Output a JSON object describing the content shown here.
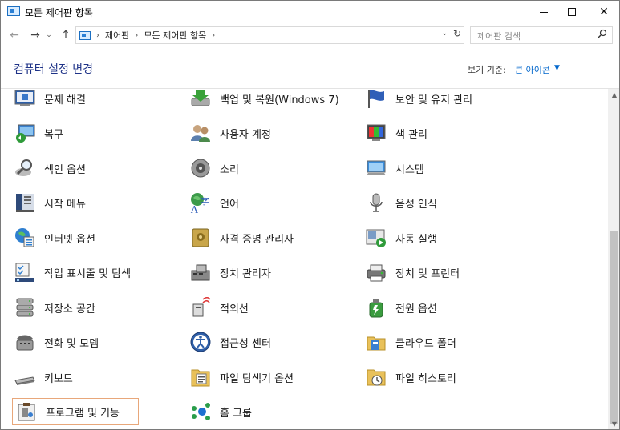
{
  "window": {
    "title": "모든 제어판 항목",
    "controls": {
      "minimize": "minimize",
      "maximize": "maximize",
      "close": "✕"
    }
  },
  "nav": {
    "back": "←",
    "forward": "→",
    "recent": "⌄",
    "up": "↑",
    "breadcrumbs": [
      "제어판",
      "모든 제어판 항목"
    ],
    "dropdown": "⌄",
    "refresh": "↻"
  },
  "search": {
    "placeholder": "제어판 검색"
  },
  "header": {
    "title": "컴퓨터 설정 변경",
    "view_by_label": "보기 기준:",
    "view_by_value": "큰 아이콘",
    "view_by_caret": "▼"
  },
  "items": [
    {
      "label": "문제 해결",
      "icon": "troubleshooting-icon"
    },
    {
      "label": "백업 및 복원(Windows 7)",
      "icon": "backup-restore-icon"
    },
    {
      "label": "보안 및 유지 관리",
      "icon": "security-flag-icon"
    },
    {
      "label": "복구",
      "icon": "recovery-icon"
    },
    {
      "label": "사용자 계정",
      "icon": "user-accounts-icon"
    },
    {
      "label": "색 관리",
      "icon": "color-management-icon"
    },
    {
      "label": "색인 옵션",
      "icon": "indexing-options-icon"
    },
    {
      "label": "소리",
      "icon": "sound-icon"
    },
    {
      "label": "시스템",
      "icon": "system-icon"
    },
    {
      "label": "시작 메뉴",
      "icon": "start-menu-icon"
    },
    {
      "label": "언어",
      "icon": "language-icon"
    },
    {
      "label": "음성 인식",
      "icon": "speech-recognition-icon"
    },
    {
      "label": "인터넷 옵션",
      "icon": "internet-options-icon"
    },
    {
      "label": "자격 증명 관리자",
      "icon": "credential-manager-icon"
    },
    {
      "label": "자동 실행",
      "icon": "autoplay-icon"
    },
    {
      "label": "작업 표시줄 및 탐색",
      "icon": "taskbar-navigation-icon"
    },
    {
      "label": "장치 관리자",
      "icon": "device-manager-icon"
    },
    {
      "label": "장치 및 프린터",
      "icon": "devices-printers-icon"
    },
    {
      "label": "저장소 공간",
      "icon": "storage-spaces-icon"
    },
    {
      "label": "적외선",
      "icon": "infrared-icon"
    },
    {
      "label": "전원 옵션",
      "icon": "power-options-icon"
    },
    {
      "label": "전화 및 모뎀",
      "icon": "phone-modem-icon"
    },
    {
      "label": "접근성 센터",
      "icon": "ease-of-access-icon"
    },
    {
      "label": "클라우드 폴더",
      "icon": "work-folders-icon"
    },
    {
      "label": "키보드",
      "icon": "keyboard-icon"
    },
    {
      "label": "파일 탐색기 옵션",
      "icon": "file-explorer-options-icon"
    },
    {
      "label": "파일 히스토리",
      "icon": "file-history-icon"
    },
    {
      "label": "프로그램 및 기능",
      "icon": "programs-features-icon",
      "selected": true
    },
    {
      "label": "홈 그룹",
      "icon": "homegroup-icon"
    }
  ],
  "colors": {
    "title_blue": "#1e3287",
    "link_blue": "#0066cc",
    "selection_border": "#e8a77a"
  }
}
